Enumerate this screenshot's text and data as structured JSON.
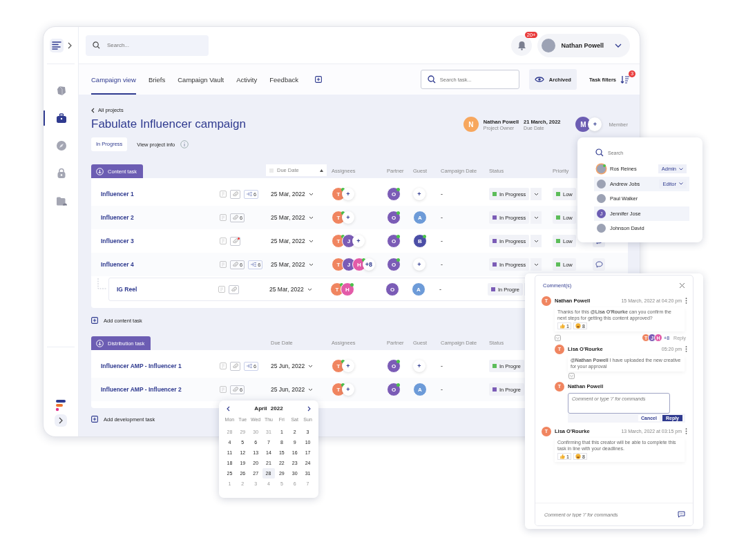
{
  "sidebar": {
    "nav": [
      {
        "kind": "cube",
        "selected": false
      },
      {
        "kind": "briefcase",
        "selected": true
      },
      {
        "kind": "compass",
        "selected": false
      },
      {
        "kind": "lock",
        "selected": false
      },
      {
        "kind": "folder",
        "selected": false
      }
    ]
  },
  "topbar": {
    "search_placeholder": "Search...",
    "notification_badge": "20+",
    "user_name": "Nathan Powell"
  },
  "tabs": [
    {
      "label": "Campaign view",
      "selected": true
    },
    {
      "label": "Briefs",
      "selected": false
    },
    {
      "label": "Campaign Vault",
      "selected": false
    },
    {
      "label": "Activity",
      "selected": false
    },
    {
      "label": "Feedback",
      "selected": false
    }
  ],
  "toolbar": {
    "search_placeholder": "Search task...",
    "archived": "Archived",
    "filters": "Task filters",
    "filter_badge": "3"
  },
  "project": {
    "back": "All projects",
    "title": "Fabulate Influencer campaign",
    "status": "In Progress",
    "info": "View project info",
    "owner": {
      "initial": "N",
      "name": "Nathan Powell",
      "role": "Project Owner"
    },
    "due": {
      "date": "21 March, 2022",
      "label": "Due Date"
    },
    "member": {
      "initial": "M",
      "add": "+",
      "label": "Member"
    }
  },
  "sections": [
    {
      "title": "Content task",
      "add_label": "Add content task",
      "columns": [
        {
          "label": "Due Date",
          "kind": "sort"
        },
        {
          "label": "Assignees",
          "kind": "plain"
        },
        {
          "label": "Partner",
          "kind": "plain"
        },
        {
          "label": "Guest",
          "kind": "plain"
        },
        {
          "label": "Campaign Date",
          "kind": "plain"
        },
        {
          "label": "Status",
          "kind": "plain"
        },
        {
          "label": "Priority",
          "kind": "plain"
        }
      ],
      "rows": [
        {
          "name": "Influencer 1",
          "subtask_count": "6",
          "alert": false,
          "due": "25 Mar, 2022",
          "assignees": [
            {
              "initial": "T",
              "color": "#f08560",
              "online": true
            }
          ],
          "assignee_more": "+",
          "partner": {
            "initial": "O",
            "color": "#7b5cb6",
            "online": true
          },
          "guest": {
            "kind": "add",
            "label": "+"
          },
          "campaign_date": "-",
          "status": {
            "label": "In Progress",
            "color": "#5dbd5a"
          },
          "priority": {
            "label": "Low",
            "color": "#5dbd5a"
          },
          "has_comment": false
        },
        {
          "name": "Influencer 2",
          "attachment_count": "6",
          "alert": false,
          "due": "25 Mar, 2022",
          "assignees": [
            {
              "initial": "T",
              "color": "#f08560",
              "online": true
            }
          ],
          "assignee_more": "+",
          "partner": {
            "initial": "O",
            "color": "#7b5cb6",
            "online": true
          },
          "guest": {
            "kind": "avatar",
            "initial": "A",
            "color": "#6d9bd8",
            "online": false
          },
          "campaign_date": "-",
          "status": {
            "label": "In Progress",
            "color": "#7b5cb6"
          },
          "priority": {
            "label": "Low",
            "color": "#5dbd5a"
          },
          "has_comment": false
        },
        {
          "name": "Influencer 3",
          "alert": true,
          "due": "25 Mar, 2022",
          "assignees": [
            {
              "initial": "T",
              "color": "#f08560",
              "online": true
            },
            {
              "initial": "J",
              "color": "#7b5cb6",
              "online": false
            }
          ],
          "assignee_more": "+",
          "partner": {
            "initial": "O",
            "color": "#7b5cb6",
            "online": true
          },
          "guest": {
            "kind": "avatar",
            "initial": "B",
            "color": "#4b4ea6",
            "online": true
          },
          "campaign_date": "-",
          "status": {
            "label": "In Progress",
            "color": "#7b5cb6"
          },
          "priority": {
            "label": "Low",
            "color": "#5dbd5a"
          },
          "has_comment": true
        },
        {
          "name": "Influencer 4",
          "attachment_count": "6",
          "subtask_count": "6",
          "alert": false,
          "due": "25 Mar, 2022",
          "assignees": [
            {
              "initial": "T",
              "color": "#f08560",
              "online": false
            },
            {
              "initial": "J",
              "color": "#7b5cb6",
              "online": false
            },
            {
              "initial": "H",
              "color": "#e35ba8",
              "online": true
            }
          ],
          "assignee_more": "+8",
          "partner": {
            "initial": "O",
            "color": "#7b5cb6",
            "online": true
          },
          "guest": {
            "kind": "add",
            "label": "+"
          },
          "campaign_date": "-",
          "status": {
            "label": "In Progress",
            "color": "#7b5cb6"
          },
          "priority": {
            "label": "Low",
            "color": "#5dbd5a"
          },
          "has_comment": true,
          "children": [
            {
              "name": "IG Reel",
              "alert": false,
              "due": "25 Mar, 2022",
              "assignees": [
                {
                  "initial": "T",
                  "color": "#f08560",
                  "online": true
                },
                {
                  "initial": "H",
                  "color": "#e35ba8",
                  "online": true
                }
              ],
              "partner": {
                "initial": "O",
                "color": "#7b5cb6",
                "online": false
              },
              "guest": {
                "kind": "avatar",
                "initial": "A",
                "color": "#6d9bd8",
                "online": false
              },
              "campaign_date": "-",
              "status": {
                "label": "In Progre",
                "color": "#7b5cb6"
              },
              "has_comment": false
            }
          ]
        }
      ]
    },
    {
      "title": "Distribution task",
      "add_label": "Add development task",
      "columns": [
        {
          "label": "Due Date",
          "kind": "plain"
        },
        {
          "label": "Assignees",
          "kind": "plain"
        },
        {
          "label": "Partner",
          "kind": "plain"
        },
        {
          "label": "Guest",
          "kind": "plain"
        },
        {
          "label": "Campaign Date",
          "kind": "plain"
        },
        {
          "label": "Status",
          "kind": "plain"
        }
      ],
      "rows": [
        {
          "name": "Influencer AMP - Influencer 1",
          "subtask_count": "6",
          "alert": false,
          "due": "25 Jun, 2022",
          "assignees": [
            {
              "initial": "T",
              "color": "#f08560",
              "online": true
            }
          ],
          "assignee_more": "+",
          "partner": {
            "initial": "O",
            "color": "#7b5cb6",
            "online": true
          },
          "guest": {
            "kind": "add",
            "label": "+"
          },
          "campaign_date": "-",
          "status": {
            "label": "In Progre",
            "color": "#5dbd5a"
          },
          "has_comment": false
        },
        {
          "name": "Influencer AMP - Influencer 2",
          "attachment_count": "6",
          "alert": false,
          "due": "25 Jun, 2022",
          "assignees": [
            {
              "initial": "T",
              "color": "#f08560",
              "online": true
            }
          ],
          "assignee_more": "+",
          "partner": {
            "initial": "O",
            "color": "#7b5cb6",
            "online": true
          },
          "guest": {
            "kind": "avatar",
            "initial": "A",
            "color": "#6d9bd8",
            "online": false
          },
          "campaign_date": "-",
          "status": {
            "label": "In Progre",
            "color": "#7b5cb6"
          },
          "has_comment": false
        }
      ]
    }
  ],
  "members": {
    "search_placeholder": "Search",
    "items": [
      {
        "name": "Ros Reines",
        "kind": "photo",
        "role": "Admin",
        "highlighted": false,
        "online": true
      },
      {
        "name": "Andrew Jobs",
        "kind": "photo",
        "role": "Editor",
        "highlighted": true,
        "online": false
      },
      {
        "name": "Paul Walker",
        "kind": "photo",
        "highlighted": false,
        "online": false
      },
      {
        "name": "Jennifer Jose",
        "kind": "initial",
        "initial": "J",
        "highlighted": true,
        "online": false
      },
      {
        "name": "Johnson David",
        "kind": "photo",
        "highlighted": false,
        "online": false
      }
    ]
  },
  "calendar": {
    "month": "April",
    "year": "2022",
    "weekdays": [
      "Mon",
      "Tue",
      "Wed",
      "Thu",
      "Fri",
      "Sat",
      "Sun"
    ],
    "weeks": [
      [
        {
          "d": "28",
          "muted": true,
          "selected": false
        },
        {
          "d": "29",
          "muted": true,
          "selected": false
        },
        {
          "d": "30",
          "muted": true,
          "selected": false
        },
        {
          "d": "31",
          "muted": true,
          "selected": false
        },
        {
          "d": "1",
          "muted": false,
          "selected": false
        },
        {
          "d": "2",
          "muted": false,
          "selected": false
        },
        {
          "d": "3",
          "muted": false,
          "selected": false
        }
      ],
      [
        {
          "d": "4",
          "muted": false,
          "selected": false
        },
        {
          "d": "5",
          "muted": false,
          "selected": false
        },
        {
          "d": "6",
          "muted": false,
          "selected": false
        },
        {
          "d": "7",
          "muted": false,
          "selected": false
        },
        {
          "d": "8",
          "muted": false,
          "selected": false
        },
        {
          "d": "9",
          "muted": false,
          "selected": false
        },
        {
          "d": "10",
          "muted": false,
          "selected": false
        }
      ],
      [
        {
          "d": "11",
          "muted": false,
          "selected": false
        },
        {
          "d": "12",
          "muted": false,
          "selected": false
        },
        {
          "d": "13",
          "muted": false,
          "selected": false
        },
        {
          "d": "14",
          "muted": false,
          "selected": false
        },
        {
          "d": "15",
          "muted": false,
          "selected": false
        },
        {
          "d": "16",
          "muted": false,
          "selected": false
        },
        {
          "d": "17",
          "muted": false,
          "selected": false
        }
      ],
      [
        {
          "d": "18",
          "muted": false,
          "selected": false
        },
        {
          "d": "19",
          "muted": false,
          "selected": false
        },
        {
          "d": "20",
          "muted": false,
          "selected": false
        },
        {
          "d": "21",
          "muted": false,
          "selected": false
        },
        {
          "d": "22",
          "muted": false,
          "selected": false
        },
        {
          "d": "23",
          "muted": false,
          "selected": false
        },
        {
          "d": "24",
          "muted": false,
          "selected": false
        }
      ],
      [
        {
          "d": "25",
          "muted": false,
          "selected": false
        },
        {
          "d": "26",
          "muted": false,
          "selected": false
        },
        {
          "d": "27",
          "muted": false,
          "selected": false
        },
        {
          "d": "28",
          "muted": false,
          "selected": true
        },
        {
          "d": "29",
          "muted": false,
          "selected": false
        },
        {
          "d": "30",
          "muted": false,
          "selected": false
        },
        {
          "d": "31",
          "muted": false,
          "selected": false
        }
      ],
      [
        {
          "d": "1",
          "muted": true,
          "selected": false
        },
        {
          "d": "2",
          "muted": true,
          "selected": false
        },
        {
          "d": "3",
          "muted": true,
          "selected": false
        },
        {
          "d": "4",
          "muted": true,
          "selected": false
        },
        {
          "d": "5",
          "muted": true,
          "selected": false
        },
        {
          "d": "6",
          "muted": true,
          "selected": false
        },
        {
          "d": "7",
          "muted": true,
          "selected": false
        }
      ]
    ]
  },
  "comments": {
    "title": "Comment(s)",
    "footer_placeholder": "Comment or type '/' for commands",
    "items": [
      {
        "initial": "T",
        "author": "Nathan Powell",
        "time": "15 March, 2022 at 04:20 pm",
        "text": "Thanks for this **@Lisa O'Rourke** can you confirm the next steps for getting this content approved?",
        "reactions": [
          {
            "kind": "thumbs",
            "count": "1"
          },
          {
            "kind": "laugh",
            "count": "8"
          }
        ],
        "reactors": [
          {
            "initial": "T",
            "color": "#f08560"
          },
          {
            "initial": "J",
            "color": "#7b5cb6"
          },
          {
            "initial": "H",
            "color": "#e35ba8"
          }
        ],
        "reactor_more": "+8",
        "reply_label": "Reply",
        "replies": [
          {
            "initial": "T",
            "author": "Lisa O'Rourke",
            "time": "05:20 pm",
            "text": "**@Nathan Powell** I have uploaded the new creative for your approval"
          }
        ],
        "composer": {
          "initial": "T",
          "author": "Nathan Powell",
          "placeholder": "Comment or type '/' for commands",
          "cancel": "Cancel",
          "submit": "Reply"
        }
      },
      {
        "initial": "T",
        "author": "Lisa O'Rourke",
        "time": "13 March, 2022 at 03:15 pm",
        "text": "Confirming that this creator will be able to complete this task in line with your deadlines.",
        "reactions": [
          {
            "kind": "thumbs",
            "count": "1"
          },
          {
            "kind": "laugh",
            "count": "8"
          }
        ]
      }
    ]
  }
}
